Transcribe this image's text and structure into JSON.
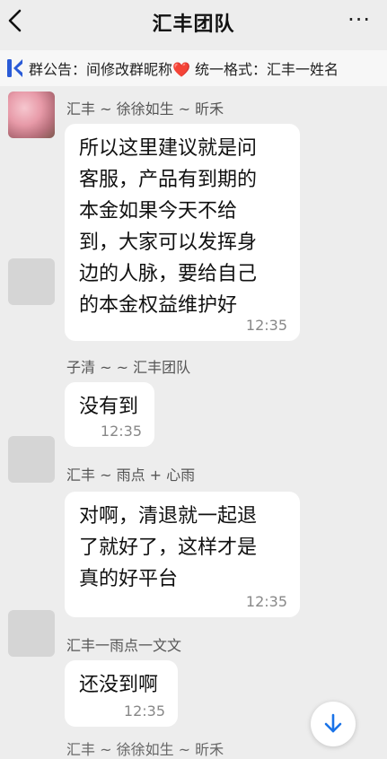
{
  "header": {
    "title": "汇丰团队",
    "more_label": "···"
  },
  "notice": {
    "text": "群公告：间修改群昵称",
    "text_after": " 统一格式：汇丰一姓名"
  },
  "messages": [
    {
      "sender": "汇丰 ~ 徐徐如生 ~ 昕禾",
      "text": "所以这里建议就是问\n客服，产品有到期的\n本金如果今天不给\n到，大家可以发挥身\n边的人脉，要给自己\n的本金权益维护好",
      "time": "12:35"
    },
    {
      "sender": "子清 ~        ~ 汇丰团队",
      "text": "没有到",
      "time": "12:35"
    },
    {
      "sender": "汇丰 ~ 雨点 + 心雨",
      "text": "对啊，清退就一起退\n了就好了，这样才是\n真的好平台",
      "time": "12:35"
    },
    {
      "sender": "汇丰一雨点一文文",
      "text": "还没到啊",
      "time": "12:35"
    }
  ],
  "partial_sender": "汇丰 ~ 徐徐如生 ~ 昕禾",
  "colors": {
    "background": "#ededed",
    "bubble": "#ffffff",
    "accent": "#1a73e8",
    "heart": "#e53935"
  }
}
